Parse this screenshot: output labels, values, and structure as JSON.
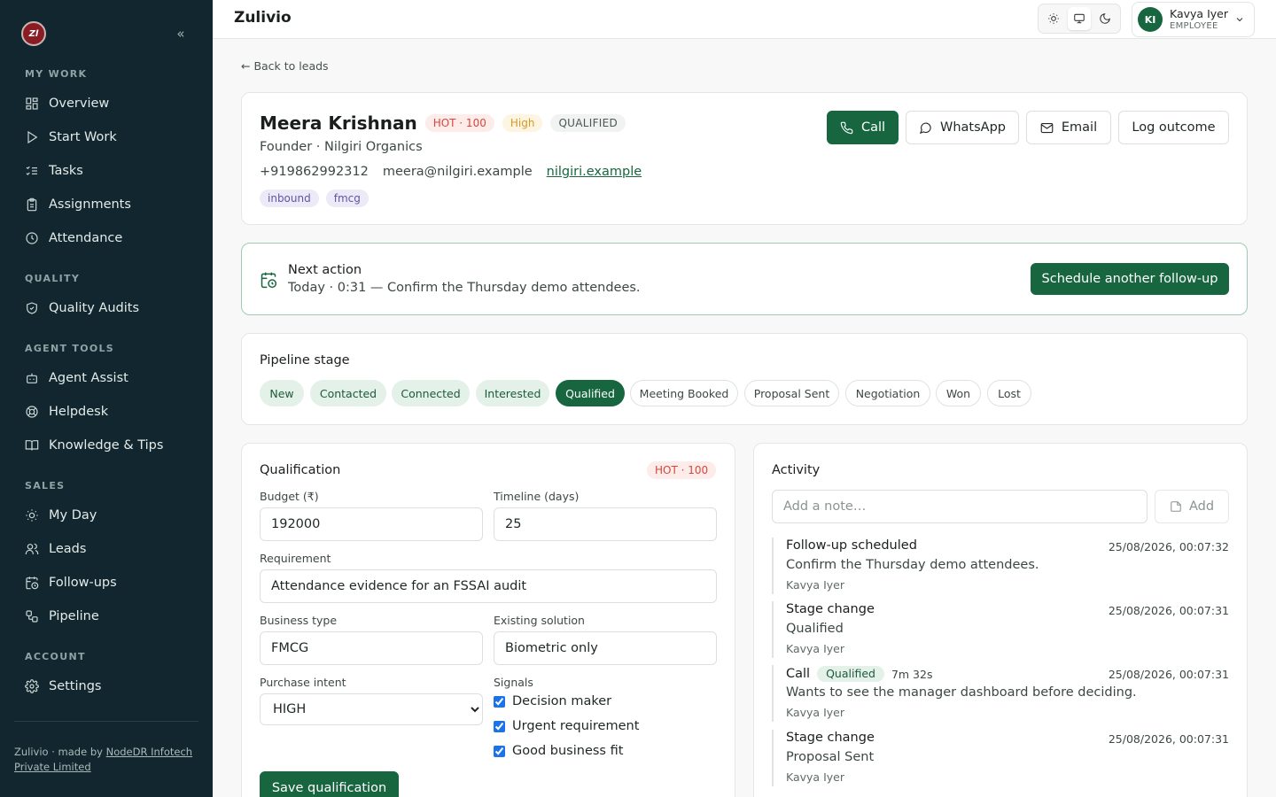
{
  "app": {
    "brand": "Zulivio"
  },
  "sidebar": {
    "logo_text": "Zl",
    "sections": [
      {
        "title": "MY WORK",
        "items": [
          {
            "label": "Overview",
            "icon": "grid-icon"
          },
          {
            "label": "Start Work",
            "icon": "play-icon"
          },
          {
            "label": "Tasks",
            "icon": "list-check-icon"
          },
          {
            "label": "Assignments",
            "icon": "clipboard-icon"
          },
          {
            "label": "Attendance",
            "icon": "clock-icon"
          }
        ]
      },
      {
        "title": "QUALITY",
        "items": [
          {
            "label": "Quality Audits",
            "icon": "shield-check-icon"
          }
        ]
      },
      {
        "title": "AGENT TOOLS",
        "items": [
          {
            "label": "Agent Assist",
            "icon": "bot-icon"
          },
          {
            "label": "Helpdesk",
            "icon": "lifebuoy-icon"
          },
          {
            "label": "Knowledge & Tips",
            "icon": "book-icon"
          }
        ]
      },
      {
        "title": "SALES",
        "items": [
          {
            "label": "My Day",
            "icon": "sun-icon"
          },
          {
            "label": "Leads",
            "icon": "users-icon"
          },
          {
            "label": "Follow-ups",
            "icon": "calendar-clock-icon"
          },
          {
            "label": "Pipeline",
            "icon": "workflow-icon"
          }
        ]
      },
      {
        "title": "ACCOUNT",
        "items": [
          {
            "label": "Settings",
            "icon": "gear-icon"
          }
        ]
      }
    ],
    "footer": {
      "prefix": "Zulivio · made by ",
      "link": "NodeDR Infotech Private Limited"
    }
  },
  "topbar": {
    "theme_options": [
      "light",
      "system",
      "dark"
    ],
    "theme_selected": "system",
    "user": {
      "initials": "KI",
      "name": "Kavya Iyer",
      "role": "EMPLOYEE"
    }
  },
  "back_link": "← Back to leads",
  "lead": {
    "name": "Meera Krishnan",
    "score_badge": "HOT · 100",
    "priority_badge": "High",
    "status_badge": "QUALIFIED",
    "subtitle": "Founder · Nilgiri Organics",
    "phone": "+919862992312",
    "email": "meera@nilgiri.example",
    "website": "nilgiri.example",
    "tags": [
      "inbound",
      "fmcg"
    ],
    "actions": {
      "call": "Call",
      "whatsapp": "WhatsApp",
      "email": "Email",
      "log": "Log outcome"
    }
  },
  "next_action": {
    "title": "Next action",
    "text": "Today · 0:31 — Confirm the Thursday demo attendees.",
    "button": "Schedule another follow-up"
  },
  "pipeline": {
    "title": "Pipeline stage",
    "stages": [
      "New",
      "Contacted",
      "Connected",
      "Interested",
      "Qualified",
      "Meeting Booked",
      "Proposal Sent",
      "Negotiation",
      "Won",
      "Lost"
    ],
    "current": "Qualified"
  },
  "qualification": {
    "title": "Qualification",
    "badge": "HOT · 100",
    "budget_label": "Budget (₹)",
    "budget": "192000",
    "timeline_label": "Timeline (days)",
    "timeline": "25",
    "requirement_label": "Requirement",
    "requirement": "Attendance evidence for an FSSAI audit",
    "business_type_label": "Business type",
    "business_type": "FMCG",
    "existing_solution_label": "Existing solution",
    "existing_solution": "Biometric only",
    "intent_label": "Purchase intent",
    "intent": "HIGH",
    "signals_label": "Signals",
    "signals": [
      {
        "label": "Decision maker",
        "checked": true
      },
      {
        "label": "Urgent requirement",
        "checked": true
      },
      {
        "label": "Good business fit",
        "checked": true
      }
    ],
    "save_button": "Save qualification"
  },
  "activity": {
    "title": "Activity",
    "note_placeholder": "Add a note…",
    "add_button": "Add",
    "items": [
      {
        "title": "Follow-up scheduled",
        "time": "25/08/2026, 00:07:32",
        "body": "Confirm the Thursday demo attendees.",
        "by": "Kavya Iyer"
      },
      {
        "title": "Stage change",
        "time": "25/08/2026, 00:07:31",
        "body": "Qualified",
        "by": "Kavya Iyer"
      },
      {
        "title": "Call",
        "badge": "Qualified",
        "duration": "7m 32s",
        "time": "25/08/2026, 00:07:31",
        "body": "Wants to see the manager dashboard before deciding.",
        "by": "Kavya Iyer"
      },
      {
        "title": "Stage change",
        "time": "25/08/2026, 00:07:31",
        "body": "Proposal Sent",
        "by": "Kavya Iyer"
      }
    ]
  },
  "colors": {
    "primary": "#17663f",
    "sidebar": "#12262f",
    "hot": "#d4473b",
    "high": "#d49a22"
  }
}
